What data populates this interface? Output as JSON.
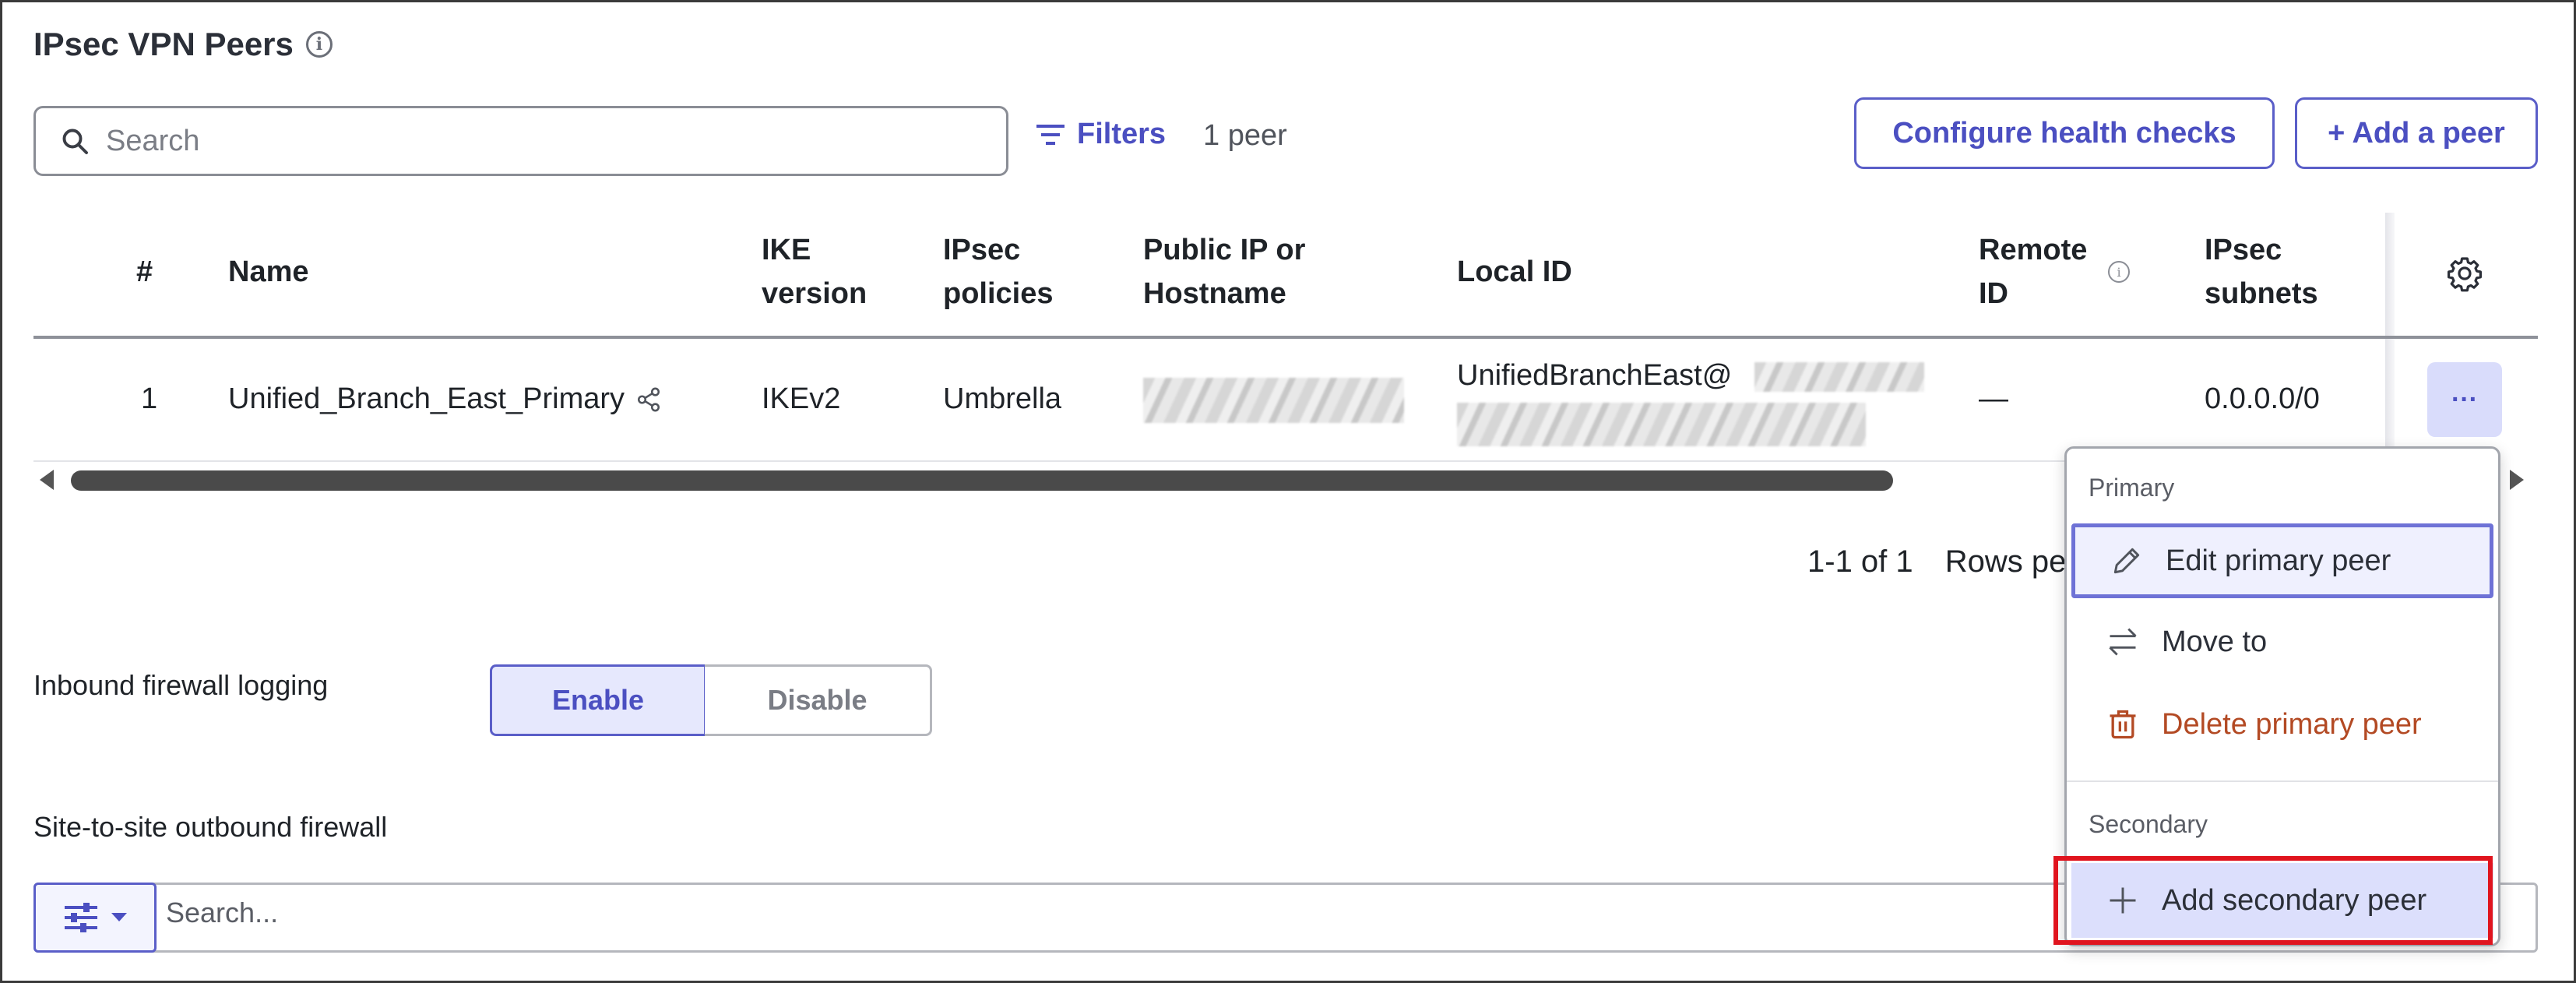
{
  "page": {
    "title": "IPsec VPN Peers"
  },
  "toolbar": {
    "search_placeholder": "Search",
    "filters_label": "Filters",
    "result_count": "1 peer",
    "configure_label": "Configure health checks",
    "add_peer_label": "+ Add a peer"
  },
  "table": {
    "headers": {
      "num": "#",
      "name": "Name",
      "ike_1": "IKE",
      "ike_2": "version",
      "policies_1": "IPsec",
      "policies_2": "policies",
      "public_1": "Public IP or",
      "public_2": "Hostname",
      "local": "Local ID",
      "remote_1": "Remote",
      "remote_2": "ID",
      "subnets_1": "IPsec",
      "subnets_2": "subnets"
    },
    "rows": [
      {
        "num": "1",
        "name": "Unified_Branch_East_Primary",
        "ike": "IKEv2",
        "policies": "Umbrella",
        "local_id": "UnifiedBranchEast@",
        "remote_id": "—",
        "subnets": "0.0.0.0/0",
        "actions": "···"
      }
    ]
  },
  "pagination": {
    "range": "1-1 of 1",
    "rows_per_page": "Rows pe"
  },
  "inbound": {
    "label": "Inbound firewall logging",
    "enable": "Enable",
    "disable": "Disable"
  },
  "outbound": {
    "label": "Site-to-site outbound firewall",
    "search_placeholder": "Search...",
    "peek_text": "v"
  },
  "menu": {
    "primary_heading": "Primary",
    "edit_primary": "Edit primary peer",
    "move_to": "Move to",
    "delete_primary": "Delete primary peer",
    "secondary_heading": "Secondary",
    "add_secondary": "Add secondary peer"
  },
  "colors": {
    "accent": "#4b4fc1",
    "danger": "#b34a24",
    "highlight": "#e0141e"
  }
}
